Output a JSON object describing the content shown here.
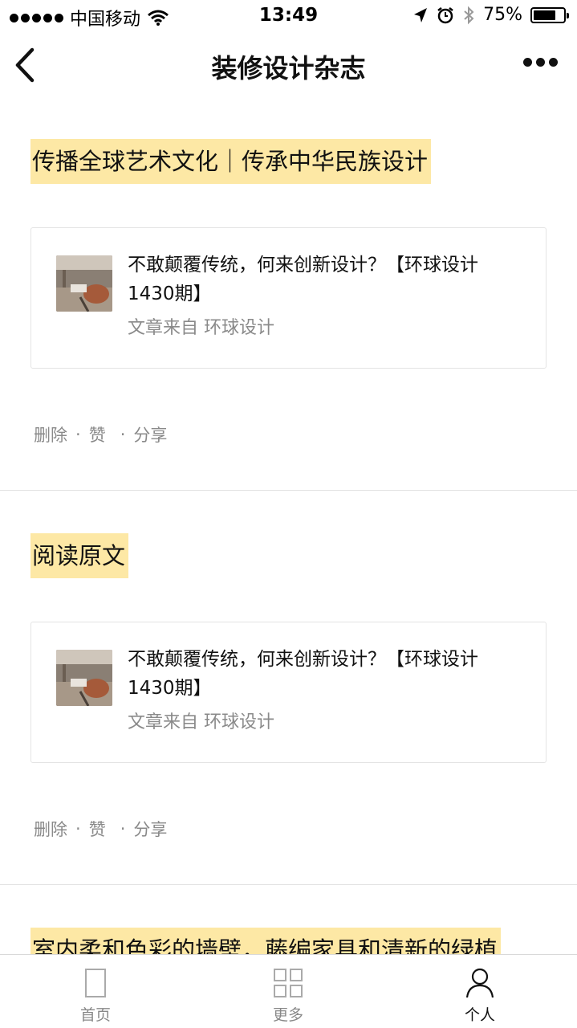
{
  "status_bar": {
    "carrier": "中国移动",
    "time": "13:49",
    "battery_text": "75%",
    "battery_level": 0.75
  },
  "nav": {
    "title": "装修设计杂志"
  },
  "posts": [
    {
      "text": "传播全球艺术文化｜传承中华民族设计",
      "card_title": "不敢颠覆传统，何来创新设计？【环球设计1430期】",
      "card_source": "文章来自 环球设计",
      "actions": {
        "delete": "删除",
        "like": "赞",
        "share": "分享",
        "dot": "·"
      }
    },
    {
      "text": "阅读原文",
      "card_title": "不敢颠覆传统，何来创新设计？【环球设计1430期】",
      "card_source": "文章来自 环球设计",
      "actions": {
        "delete": "删除",
        "like": "赞",
        "share": "分享",
        "dot": "·"
      }
    },
    {
      "text": "室内柔和色彩的墙壁，藤编家具和清新的绿植"
    }
  ],
  "tabbar": {
    "items": [
      {
        "label": "首页",
        "icon": "page-icon"
      },
      {
        "label": "更多",
        "icon": "grid-icon"
      },
      {
        "label": "个人",
        "icon": "person-icon",
        "active": true
      }
    ]
  },
  "colors": {
    "highlight": "#fde8a5",
    "muted_text": "#8a8a8a",
    "divider": "#e2e2e2"
  }
}
